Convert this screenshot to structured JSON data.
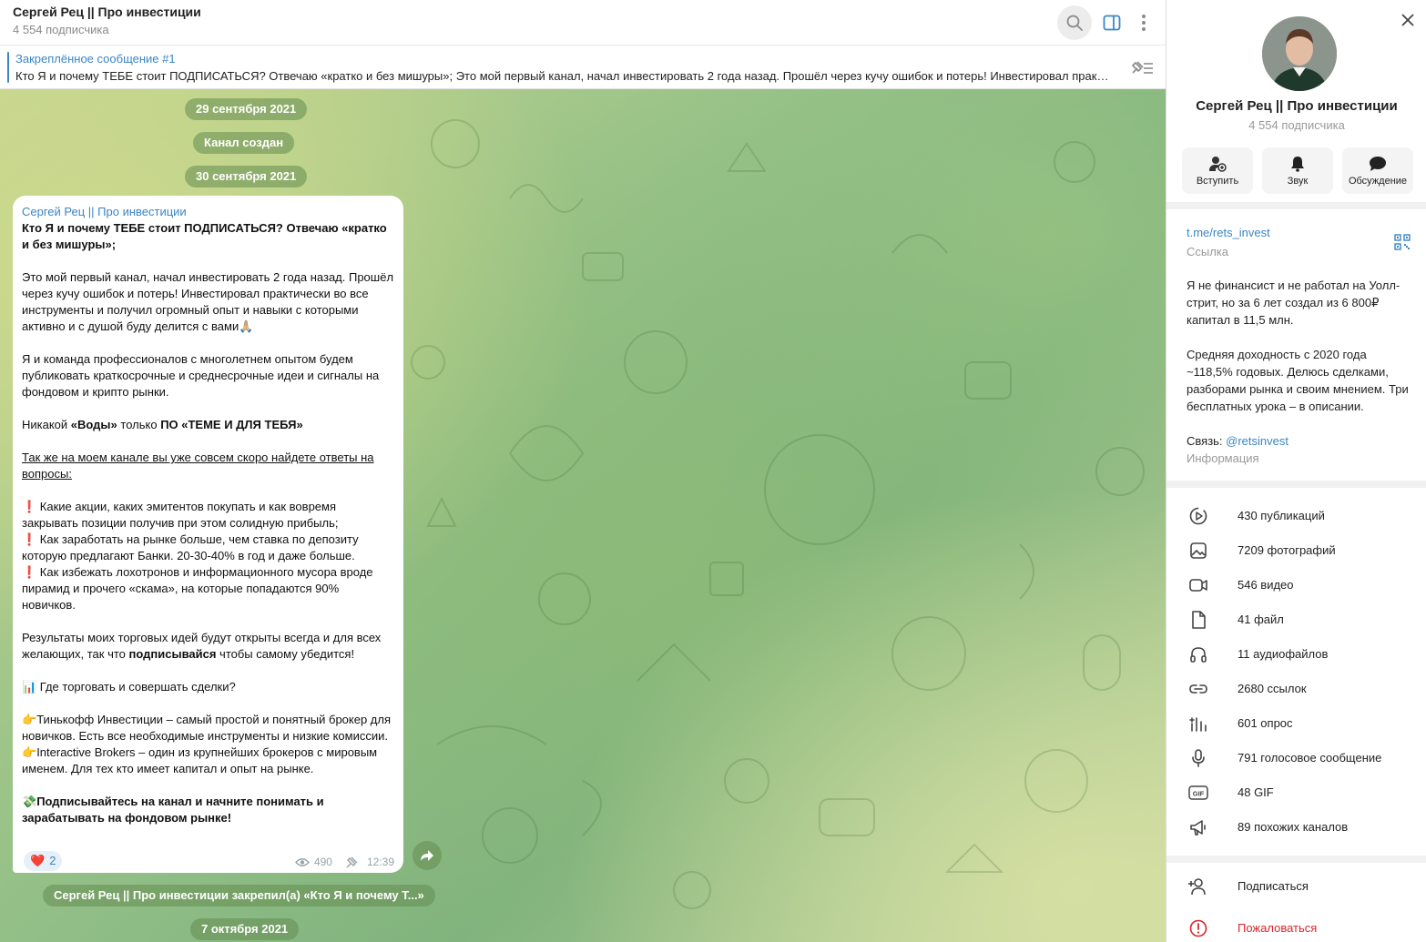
{
  "header": {
    "title": "Сергей Рец || Про инвестиции",
    "subscribers": "4 554 подписчика"
  },
  "pinned": {
    "title": "Закреплённое сообщение #1",
    "text": "Кто Я и почему ТЕБЕ стоит  ПОДПИСАТЬСЯ? Отвечаю «кратко и без мишуры»;   Это мой первый канал, начал инвестировать 2 года назад.  Прошёл через кучу ошибок и потерь! Инвестировал практически во все инструменты и получил огромный опыт"
  },
  "service": {
    "date1": "29 сентября 2021",
    "created": "Канал создан",
    "date2": "30 сентября 2021",
    "pinned_notice": "Сергей Рец || Про инвестиции закрепил(а) «Кто Я и почему Т...»",
    "date3": "7 октября 2021"
  },
  "message": {
    "author": "Сергей Рец || Про инвестиции",
    "headline": "Кто Я и почему ТЕБЕ стоит  ПОДПИСАТЬСЯ? Отвечаю «кратко и без мишуры»;",
    "para1": "Это мой первый канал, начал инвестировать 2 года назад. Прошёл через кучу ошибок и потерь! Инвестировал практически во все инструменты и получил огромный опыт и навыки с которыми активно и с душой буду делится с вами",
    "emoji_pray": "🙏🏼",
    "para2": "Я и команда профессионалов с многолетнем опытом будем публиковать краткосрочные и среднесрочные идеи и сигналы на фондовом и крипто рынки.",
    "para3_a": "Никакой ",
    "para3_b": "«Воды»",
    "para3_c": " только ",
    "para3_d": "ПО «ТЕМЕ И ДЛЯ ТЕБЯ»",
    "para4": "Так же на моем канале вы уже совсем скоро найдете ответы на вопросы:",
    "excl": "❗",
    "q1": " Какие акции, каких эмитентов покупать и как вовремя закрывать позиции получив при этом солидную прибыль;",
    "q2": " Как заработать на рынке больше, чем ставка по депозиту которую предлагают Банки. 20-30-40% в год и даже больше.",
    "q3": " Как избежать лохотронов и информационного мусора вроде пирамид и прочего «скама», на которые попадаются 90% новичков.",
    "para5_a": "Результаты моих торговых идей будут открыты всегда и для всех желающих, так что ",
    "para5_b": "подписывайся",
    "para5_c": " чтобы самому убедится!",
    "chart_emoji": "📊",
    "para6": " Где торговать и совершать сделки?",
    "point": "👉",
    "broker1": "Тинькофф Инвестиции – самый простой и понятный брокер для новичков. Есть все необходимые инструменты и низкие комиссии.",
    "broker2": "Interactive Brokers – один из крупнейших брокеров с мировым именем. Для тех кто имеет капитал и опыт на рынке.",
    "money_emoji": "💸",
    "cta": "Подписывайтесь на канал и начните понимать и зарабатывать на фондовом рынке!",
    "reaction_emoji": "❤️",
    "reaction_count": "2",
    "views": "490",
    "time": "12:39"
  },
  "profile": {
    "name": "Сергей Рец || Про инвестиции",
    "subscribers": "4 554 подписчика",
    "actions": [
      {
        "label": "Вступить",
        "icon": "add-user-icon"
      },
      {
        "label": "Звук",
        "icon": "bell-icon"
      },
      {
        "label": "Обсуждение",
        "icon": "chat-bubble-icon"
      }
    ],
    "link": "t.me/rets_invest",
    "link_label": "Ссылка",
    "desc1": "Я не финансист и не работал на Уолл-стрит, но за 6 лет создал из 6 800₽ капитал в 11,5 млн.",
    "desc2": "Средняя доходность с 2020 года ~118,5% годовых. Делюсь сделками, разборами рынка и своим мнением. Три бесплатных урока – в описании.",
    "contact_prefix": "Связь: ",
    "contact_handle": "@retsinvest",
    "info_label": "Информация",
    "stats": [
      {
        "icon": "posts-icon",
        "text": "430 публикаций"
      },
      {
        "icon": "photo-icon",
        "text": "7209 фотографий"
      },
      {
        "icon": "video-icon",
        "text": "546 видео"
      },
      {
        "icon": "file-icon",
        "text": "41 файл"
      },
      {
        "icon": "headphones-icon",
        "text": "11 аудиофайлов"
      },
      {
        "icon": "link-icon",
        "text": "2680 ссылок"
      },
      {
        "icon": "poll-icon",
        "text": "601 опрос"
      },
      {
        "icon": "microphone-icon",
        "text": "791 голосовое сообщение"
      },
      {
        "icon": "gif-icon",
        "text": "48 GIF"
      },
      {
        "icon": "megaphone-icon",
        "text": "89 похожих каналов"
      }
    ],
    "subscribe": "Подписаться",
    "report": "Пожаловаться"
  },
  "colors": {
    "accent": "#3a86c5",
    "danger": "#d8262d",
    "pill": "#6f9a5c"
  }
}
